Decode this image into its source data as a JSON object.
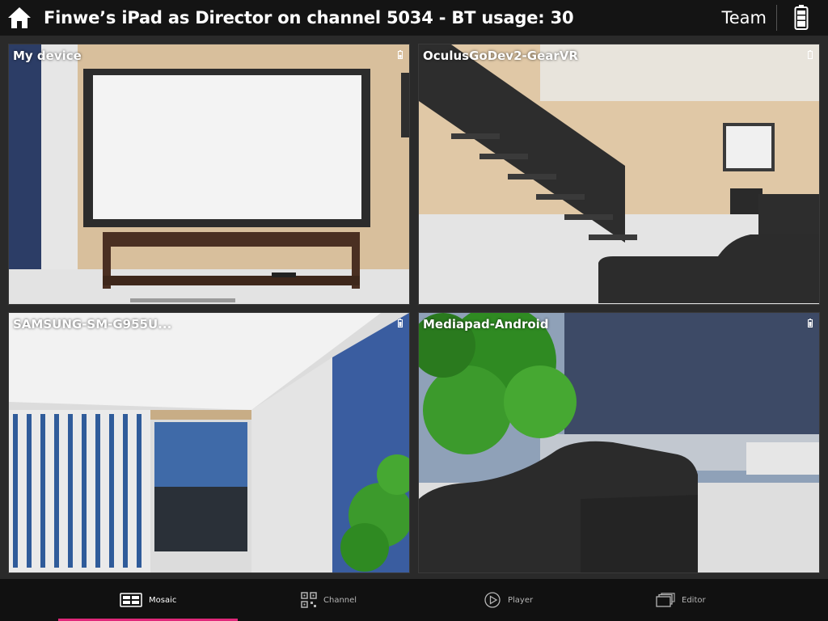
{
  "header": {
    "title": "Finwe’s iPad as Director on channel 5034 - BT usage: 30",
    "team_label": "Team"
  },
  "tiles": [
    {
      "label": "My device"
    },
    {
      "label": "OculusGoDev2-GearVR"
    },
    {
      "label": "SAMSUNG-SM-G955U..."
    },
    {
      "label": "Mediapad-Android"
    }
  ],
  "tabs": [
    {
      "label": "Mosaic",
      "icon": "mosaic-icon",
      "active": true
    },
    {
      "label": "Channel",
      "icon": "qr-code-icon",
      "active": false
    },
    {
      "label": "Player",
      "icon": "play-circle-icon",
      "active": false
    },
    {
      "label": "Editor",
      "icon": "stacked-pages-icon",
      "active": false
    }
  ],
  "colors": {
    "accent": "#e0287a",
    "topbar": "#141414",
    "bottombar": "#111111"
  }
}
